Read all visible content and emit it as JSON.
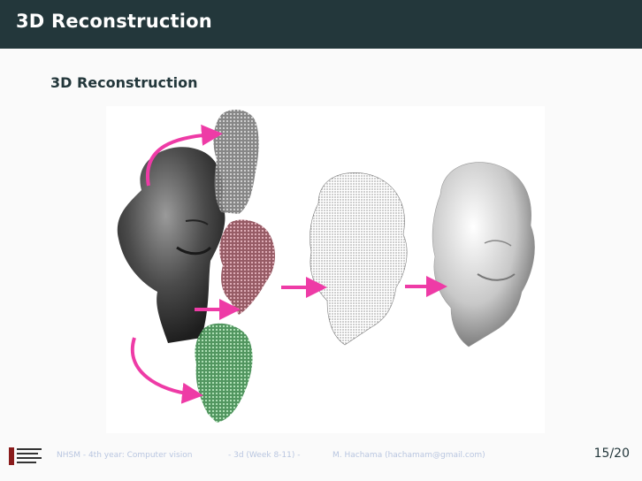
{
  "header": {
    "title": "3D Reconstruction"
  },
  "block": {
    "title": "3D Reconstruction"
  },
  "figure": {
    "arrow_color": "#ee3ba6",
    "stages": [
      "bronze-head-photo",
      "depth-scan-top",
      "depth-scan-middle",
      "depth-scan-bottom",
      "point-cloud",
      "reconstructed-mesh"
    ]
  },
  "footer": {
    "course": "NHSM - 4th year: Computer vision",
    "session": "- 3d (Week 8-11) -",
    "author": "M. Hachama (hachamam@gmail.com)",
    "page": "15/20"
  }
}
